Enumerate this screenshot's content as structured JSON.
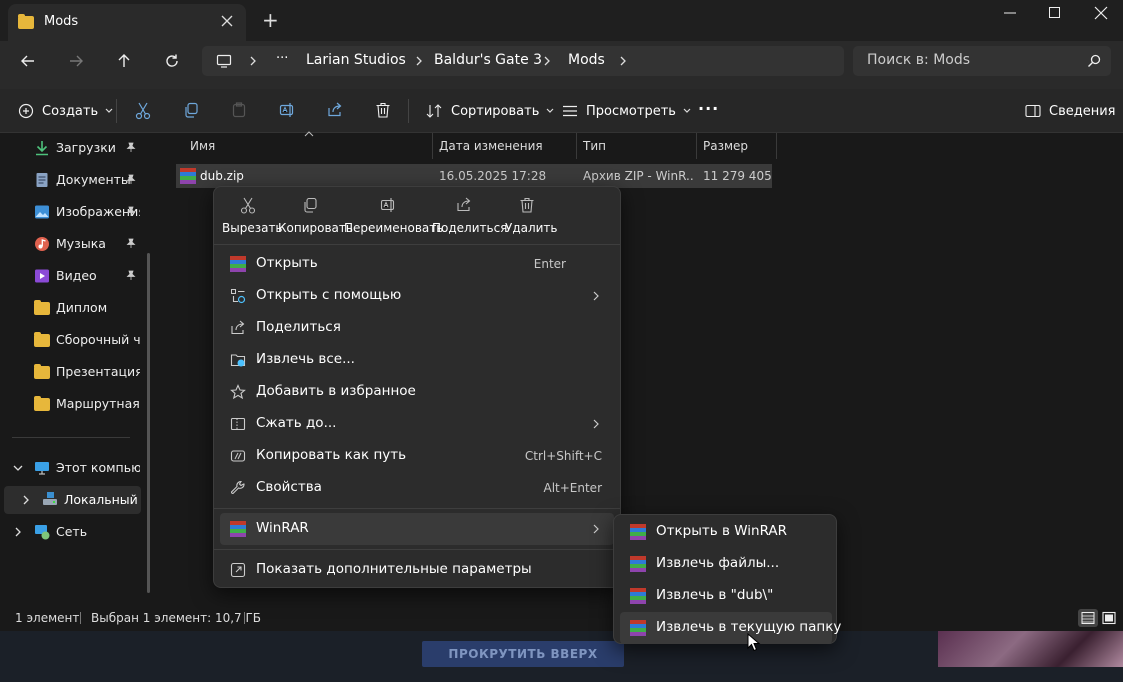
{
  "window": {
    "tab_title": "Mods",
    "new_tab": "+",
    "controls": [
      "minimize",
      "maximize",
      "close"
    ]
  },
  "address": {
    "ellipsis": "···",
    "crumbs": [
      "Larian Studios",
      "Baldur's Gate 3",
      "Mods"
    ],
    "search_placeholder": "Поиск в: Mods"
  },
  "toolbar": {
    "create": "Создать",
    "sort": "Сортировать",
    "view": "Просмотреть",
    "more": "···",
    "details": "Сведения"
  },
  "sidebar": {
    "quick": [
      {
        "label": "Загрузки",
        "icon": "download-icon",
        "pinned": true
      },
      {
        "label": "Документы",
        "icon": "document-icon",
        "pinned": true
      },
      {
        "label": "Изображения",
        "icon": "image-icon",
        "pinned": true
      },
      {
        "label": "Музыка",
        "icon": "music-icon",
        "pinned": true
      },
      {
        "label": "Видео",
        "icon": "video-icon",
        "pinned": true
      },
      {
        "label": "Диплом",
        "icon": "folder-icon",
        "pinned": false
      },
      {
        "label": "Сборочный чертеж",
        "icon": "folder-icon",
        "pinned": false
      },
      {
        "label": "Презентация диплом",
        "icon": "folder-icon",
        "pinned": false
      },
      {
        "label": "Маршрутная карта",
        "icon": "folder-icon",
        "pinned": false
      }
    ],
    "this_pc": "Этот компьютер",
    "local_disk": "Локальный диск",
    "network": "Сеть"
  },
  "columns": {
    "name": "Имя",
    "modified": "Дата изменения",
    "type": "Тип",
    "size": "Размер"
  },
  "files": [
    {
      "name": "dub.zip",
      "modified": "16.05.2025 17:28",
      "type": "Архив ZIP - WinR...",
      "size": "11 279 405 ..."
    }
  ],
  "context_menu": {
    "quick_actions": [
      {
        "label": "Вырезать",
        "icon": "scissors-icon"
      },
      {
        "label": "Копировать",
        "icon": "copy-icon"
      },
      {
        "label": "Переименовать",
        "icon": "rename-icon"
      },
      {
        "label": "Поделиться",
        "icon": "share-icon"
      },
      {
        "label": "Удалить",
        "icon": "trash-icon"
      }
    ],
    "items": [
      {
        "label": "Открыть",
        "shortcut": "Enter",
        "icon": "winrar-icon"
      },
      {
        "label": "Открыть с помощью",
        "shortcut": "",
        "icon": "open-with-icon"
      },
      {
        "label": "Поделиться",
        "shortcut": "",
        "icon": "share-icon"
      },
      {
        "label": "Извлечь все...",
        "shortcut": "",
        "icon": "extract-icon"
      },
      {
        "label": "Добавить в избранное",
        "shortcut": "",
        "icon": "star-icon"
      },
      {
        "label": "Сжать до...",
        "shortcut": "",
        "icon": "compress-icon"
      },
      {
        "label": "Копировать как путь",
        "shortcut": "Ctrl+Shift+C",
        "icon": "path-icon"
      },
      {
        "label": "Свойства",
        "shortcut": "Alt+Enter",
        "icon": "wrench-icon"
      }
    ],
    "winrar": "WinRAR",
    "more_options": "Показать дополнительные параметры"
  },
  "winrar_submenu": [
    "Открыть в WinRAR",
    "Извлечь файлы...",
    "Извлечь в \"dub\\\"",
    "Извлечь в текущую папку"
  ],
  "status": {
    "count": "1 элемент",
    "selected": "Выбран 1 элемент: 10,7 ГБ"
  },
  "background": {
    "scroll_top_button": "ПРОКРУТИТЬ ВВЕРХ"
  },
  "colors": {
    "accent": "#4cc2ff",
    "folder": "#e7b73b",
    "menu_bg": "#2c2c2c",
    "selection": "#3a3a3a"
  }
}
